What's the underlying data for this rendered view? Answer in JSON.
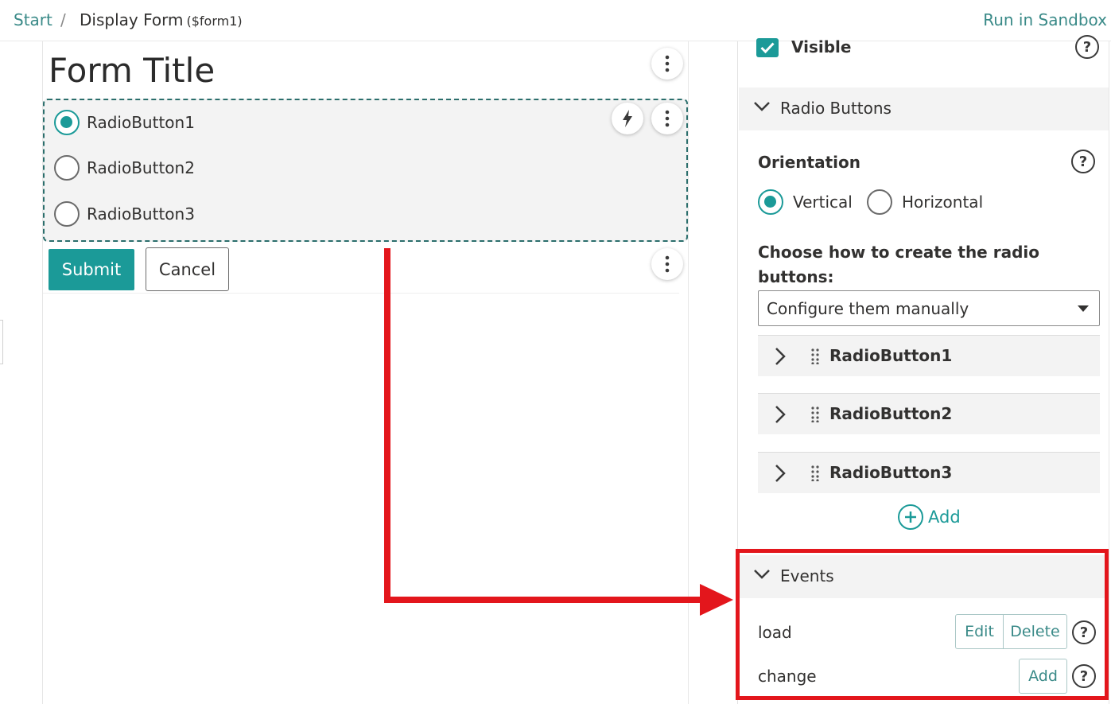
{
  "breadcrumb": {
    "start": "Start",
    "separator": "/",
    "current": "Display Form",
    "current_id": "($form1)"
  },
  "header": {
    "run_sandbox": "Run in Sandbox"
  },
  "form": {
    "title": "Form Title",
    "radio_buttons": [
      {
        "label": "RadioButton1",
        "checked": true
      },
      {
        "label": "RadioButton2",
        "checked": false
      },
      {
        "label": "RadioButton3",
        "checked": false
      }
    ],
    "submit_label": "Submit",
    "cancel_label": "Cancel"
  },
  "panel": {
    "visible_label": "Visible",
    "visible_checked": true,
    "radio_section_title": "Radio Buttons",
    "orientation_label": "Orientation",
    "orientation_options": [
      "Vertical",
      "Horizontal"
    ],
    "orientation_selected": "Vertical",
    "choose_label": "Choose how to create the radio buttons:",
    "create_select_value": "Configure them manually",
    "items": [
      "RadioButton1",
      "RadioButton2",
      "RadioButton3"
    ],
    "add_label": "Add",
    "events_title": "Events",
    "events": [
      {
        "name": "load",
        "actions": [
          "Edit",
          "Delete"
        ]
      },
      {
        "name": "change",
        "actions": [
          "Add"
        ]
      }
    ],
    "help_glyph": "?"
  },
  "colors": {
    "accent": "#1b9a98",
    "link": "#3a8a88",
    "highlight": "#e3161c"
  }
}
